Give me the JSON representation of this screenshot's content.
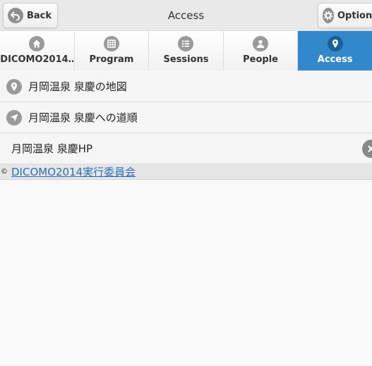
{
  "header": {
    "title": "Access",
    "back_label": "Back",
    "option_label": "Option"
  },
  "navbar": {
    "tabs": [
      {
        "label": "DICOMO2014…",
        "icon": "home-icon"
      },
      {
        "label": "Program",
        "icon": "calendar-icon"
      },
      {
        "label": "Sessions",
        "icon": "list-icon"
      },
      {
        "label": "People",
        "icon": "person-icon"
      },
      {
        "label": "Access",
        "icon": "location-icon",
        "active": true
      }
    ]
  },
  "list": {
    "items": [
      {
        "label": "月岡温泉 泉慶の地図",
        "icon": "location-icon"
      },
      {
        "label": "月岡温泉 泉慶への道順",
        "icon": "navigation-icon"
      },
      {
        "label": "月岡温泉 泉慶HP",
        "icon": "close-icon"
      }
    ]
  },
  "footer": {
    "copyright_symbol": "©",
    "link_text": "DICOMO2014実行委員会"
  },
  "colors": {
    "accent": "#3388cc",
    "icon_gray": "#9a9a9a",
    "link": "#2a6fbf"
  }
}
